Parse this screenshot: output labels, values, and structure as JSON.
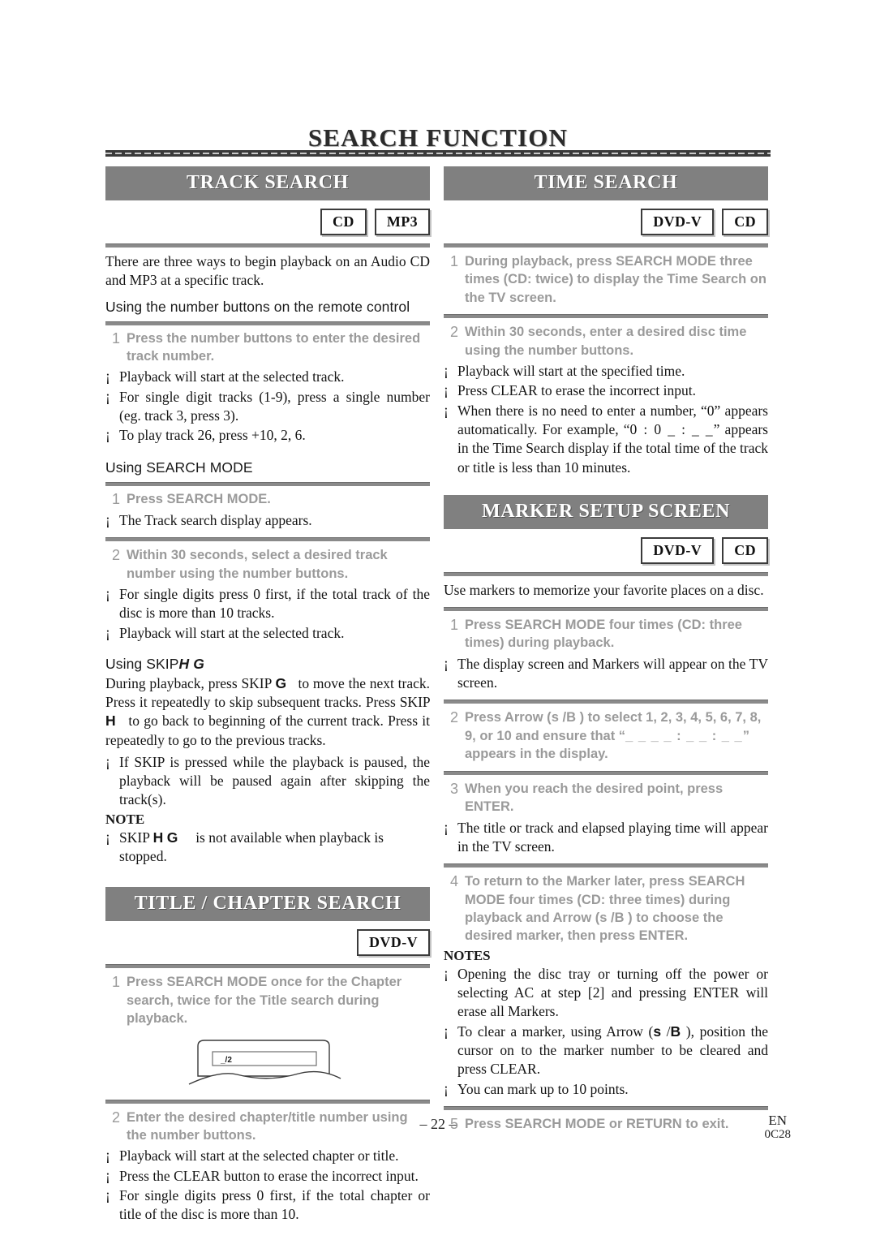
{
  "document": {
    "title": "SEARCH FUNCTION",
    "page_number": "– 22 –",
    "language_code": "EN",
    "doc_code": "0C28"
  },
  "track_search": {
    "heading": "TRACK SEARCH",
    "badges": [
      "CD",
      "MP3"
    ],
    "intro": "There are three ways to begin playback on an Audio CD and MP3 at a specific track.",
    "subhead_numbers": "Using the number buttons on the remote control",
    "step1_num": "1",
    "step1_text": "Press the number buttons to enter the desired track number.",
    "bullets_numbers": [
      "Playback will start at the selected track.",
      "For single digit tracks (1-9), press a single number (eg. track 3, press 3).",
      "To play track 26, press +10, 2, 6."
    ],
    "subhead_searchmode": "Using SEARCH MODE",
    "step2_num": "1",
    "step2_text": "Press SEARCH MODE.",
    "bullet_display": "The Track search display appears.",
    "step3_num": "2",
    "step3_text": "Within 30 seconds, select a desired track number using the number buttons.",
    "bullets_searchmode": [
      "For single digits press 0 first, if the total track of the disc is more than 10 tracks.",
      "Playback will start at the selected track."
    ],
    "subhead_skip_prefix": "Using SKIP",
    "skip_glyph_prev": "H",
    "skip_glyph_next": "G",
    "skip_para_1": "During playback, press SKIP",
    "skip_para_2": "to move the next track. Press it repeatedly to skip subsequent tracks. Press SKIP",
    "skip_para_3": "to go back to beginning of the current track. Press it repeatedly to go to the previous tracks.",
    "skip_bullet": "If SKIP is pressed while the playback is paused, the playback will be paused again after skipping the track(s).",
    "note_label": "NOTE",
    "note_prefix": "SKIP",
    "note_text": "is not available when playback is stopped."
  },
  "title_chapter_search": {
    "heading": "TITLE / CHAPTER SEARCH",
    "badges": [
      "DVD-V"
    ],
    "step1_num": "1",
    "step1_text": "Press SEARCH MODE once for the Chapter search, twice for the Title search during playback.",
    "tv_display_value": "_/2",
    "step2_num": "2",
    "step2_text": "Enter the desired chapter/title number using the number buttons.",
    "bullets": [
      "Playback will start at the selected chapter or title.",
      "Press the CLEAR button to erase the incorrect input.",
      "For single digits press 0 first, if the total chapter or title of the disc is more than 10."
    ]
  },
  "time_search": {
    "heading": "TIME SEARCH",
    "badges": [
      "DVD-V",
      "CD"
    ],
    "step1_num": "1",
    "step1_text": "During playback, press SEARCH MODE three times (CD: twice) to display the Time Search on the TV screen.",
    "step2_num": "2",
    "step2_text": "Within 30 seconds, enter a desired disc time using the number buttons.",
    "bullets": [
      "Playback will start at the specified time.",
      "Press CLEAR to erase the incorrect input."
    ],
    "bullet_example_a": "When there is no need to enter a number, “0” appears automatically. For example, “",
    "bullet_example_display": "0 : 0 _ : _ _",
    "bullet_example_b": "” appears in the Time Search display if the total time of the track or title is less than 10 minutes."
  },
  "marker_setup": {
    "heading": "MARKER SETUP SCREEN",
    "badges": [
      "DVD-V",
      "CD"
    ],
    "intro": "Use markers to memorize your favorite places on a disc.",
    "step1_num": "1",
    "step1_text": "Press SEARCH MODE four times (CD: three times) during playback.",
    "bullet1": "The display screen and Markers will appear on the TV screen.",
    "step2_num": "2",
    "step2_a": "Press Arrow (",
    "arrow_left": "s",
    "arrow_sep": "/",
    "arrow_right": "B",
    "step2_b": ") to select 1, 2, 3, 4, 5, 6, 7, 8, 9, or 10 and ensure that “",
    "step2_display": "_ _ _ _ : _ _ : _ _",
    "step2_c": "” appears in the display.",
    "step3_num": "3",
    "step3_text": "When you reach the desired point, press",
    "step3_text_bold": "ENTER.",
    "bullet2": "The title or track and elapsed playing time will appear in the TV screen.",
    "step4_num": "4",
    "step4_a": "To return to the Marker later, press SEARCH MODE four times (CD: three times) during playback and Arrow (",
    "step4_b": ") to choose the desired marker, then press ENTER.",
    "notes_label": "NOTES",
    "note1": "Opening the disc tray or turning off the power or selecting AC at step [2] and pressing ENTER will erase all Markers.",
    "note2_a": "To clear a marker, using Arrow (",
    "note2_b": "), position the cursor on to the marker number to be cleared and press CLEAR.",
    "note3": "You can mark up to 10 points.",
    "step5_num": "5",
    "step5_text": "Press SEARCH MODE or RETURN to exit."
  },
  "colors": {
    "header_bar": "#808080",
    "step_text": "#9a9a9a",
    "rule": "#8a8a8a"
  }
}
